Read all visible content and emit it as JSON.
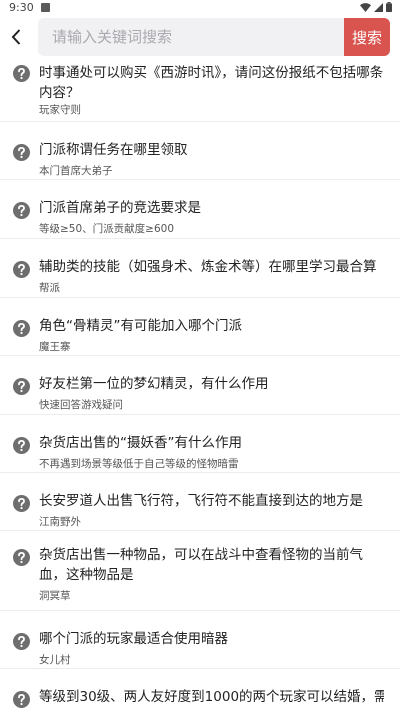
{
  "status_bar": {
    "time": "9:30"
  },
  "search": {
    "placeholder": "请输入关键词搜索",
    "button_label": "搜索"
  },
  "items": [
    {
      "question": "时事通处可以购买《西游时讯》，请问这份报纸不包括哪条内容？",
      "answer": "玩家守则"
    },
    {
      "question": "门派称谓任务在哪里领取",
      "answer": "本门首席大弟子"
    },
    {
      "question": "门派首席弟子的竞选要求是",
      "answer": "等级≥50、门派贡献度≥600"
    },
    {
      "question": "辅助类的技能（如强身术、炼金术等）在哪里学习最合算",
      "answer": "帮派"
    },
    {
      "question": "角色“骨精灵”有可能加入哪个门派",
      "answer": "魔王寨"
    },
    {
      "question": "好友栏第一位的梦幻精灵，有什么作用",
      "answer": "快速回答游戏疑问"
    },
    {
      "question": "杂货店出售的“摄妖香”有什么作用",
      "answer": "不再遇到场景等级低于自己等级的怪物暗雷"
    },
    {
      "question": "长安罗道人出售飞行符，飞行符不能直接到达的地方是",
      "answer": "江南野外"
    },
    {
      "question": "杂货店出售一种物品，可以在战斗中查看怪物的当前气血，这种物品是",
      "answer": "洞冥草"
    },
    {
      "question": "哪个门派的玩家最适合使用暗器",
      "answer": "女儿村"
    },
    {
      "question": "等级到30级、两人友好度到1000的两个玩家可以结婚，需要",
      "answer": ""
    }
  ]
}
